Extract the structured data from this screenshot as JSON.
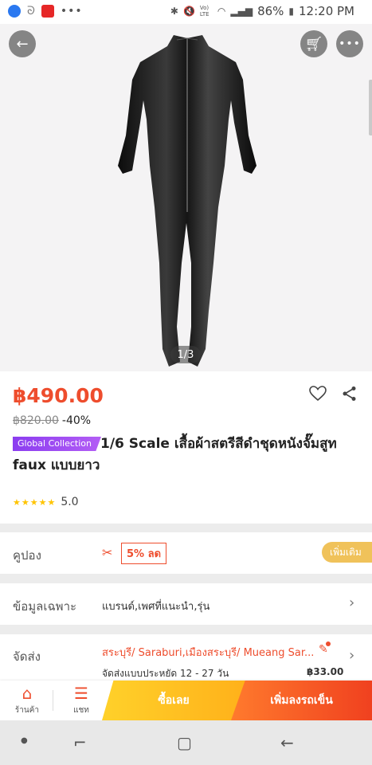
{
  "status_bar": {
    "battery": "86%",
    "time": "12:20 PM",
    "notification_dots": "•••",
    "lte_label": "Vo) LTE"
  },
  "hero": {
    "image_counter": "1/3"
  },
  "product": {
    "price": "฿490.00",
    "original_price": "฿820.00",
    "discount": "-40%",
    "badge": "Global Collection",
    "title": "1/6 Scale เสื้อผ้าสตรีสีดำชุดหนังจั๊มสูท faux แบบยาว",
    "rating": "5.0",
    "stars": "★★★★★"
  },
  "coupon": {
    "label": "คูปอง",
    "chip": "5% ลด",
    "more": "เพิ่มเติม"
  },
  "spec": {
    "label": "ข้อมูลเฉพาะ",
    "value": "แบรนด์,เพศที่แนะนำ,รุ่น"
  },
  "shipping": {
    "label": "จัดส่ง",
    "location": "สระบุรี/ Saraburi,เมืองสระบุรี/ Mueang Sar...",
    "detail": "จัดส่งแบบประหยัด  12 - 27 วัน",
    "fee": "฿33.00"
  },
  "bottom_bar": {
    "shop": "ร้านค้า",
    "chat": "แชท",
    "buy_now": "ซื้อเลย",
    "add_to_cart": "เพิ่มลงรถเข็น"
  },
  "colors": {
    "accent": "#ee4d2d",
    "buy_now": "#ffc21f",
    "add_cart": "#f25a27",
    "badge": "#9b45f2"
  }
}
